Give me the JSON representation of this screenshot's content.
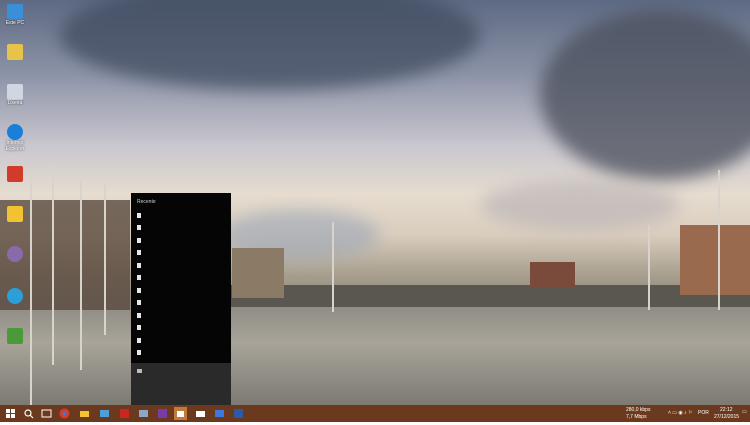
{
  "desktop": {
    "icons": [
      {
        "label": "Este PC",
        "icon": "computer-icon",
        "color": "#3b8fd9"
      },
      {
        "label": "",
        "icon": "user-folder-icon",
        "color": "#e8c34a"
      },
      {
        "label": "Lixeira",
        "icon": "recycle-bin-icon",
        "color": "#cfd8e0"
      },
      {
        "label": "Internet Explorer",
        "icon": "ie-icon",
        "color": "#1a7fd8"
      },
      {
        "label": "",
        "icon": "app-icon",
        "color": "#d23a2a"
      },
      {
        "label": "",
        "icon": "folder-icon",
        "color": "#f2c230"
      },
      {
        "label": "",
        "icon": "app-icon",
        "color": "#8a6aa8"
      },
      {
        "label": "",
        "icon": "telegram-icon",
        "color": "#2a9fd8"
      },
      {
        "label": "",
        "icon": "vpn-icon",
        "color": "#4a9a3a"
      }
    ]
  },
  "recent_panel": {
    "title": "Recente",
    "item_count": 14
  },
  "taskbar": {
    "start_icon": "windows-start-icon",
    "buttons": [
      {
        "icon": "search-icon"
      },
      {
        "icon": "task-view-icon"
      },
      {
        "icon": "chrome-icon"
      },
      {
        "icon": "explorer-icon"
      },
      {
        "icon": "store-icon"
      },
      {
        "icon": "acrobat-icon"
      },
      {
        "icon": "app-icon"
      },
      {
        "icon": "outlook-icon"
      },
      {
        "icon": "onenote-icon"
      },
      {
        "icon": "store-bag-icon"
      },
      {
        "icon": "mail-icon"
      },
      {
        "icon": "photos-icon"
      },
      {
        "icon": "word-icon"
      }
    ],
    "tray": {
      "net_up": "280,0 kbps",
      "net_down": "7,7 Mbps",
      "language": "POR",
      "time": "22:12",
      "date": "27/12/2015"
    }
  }
}
